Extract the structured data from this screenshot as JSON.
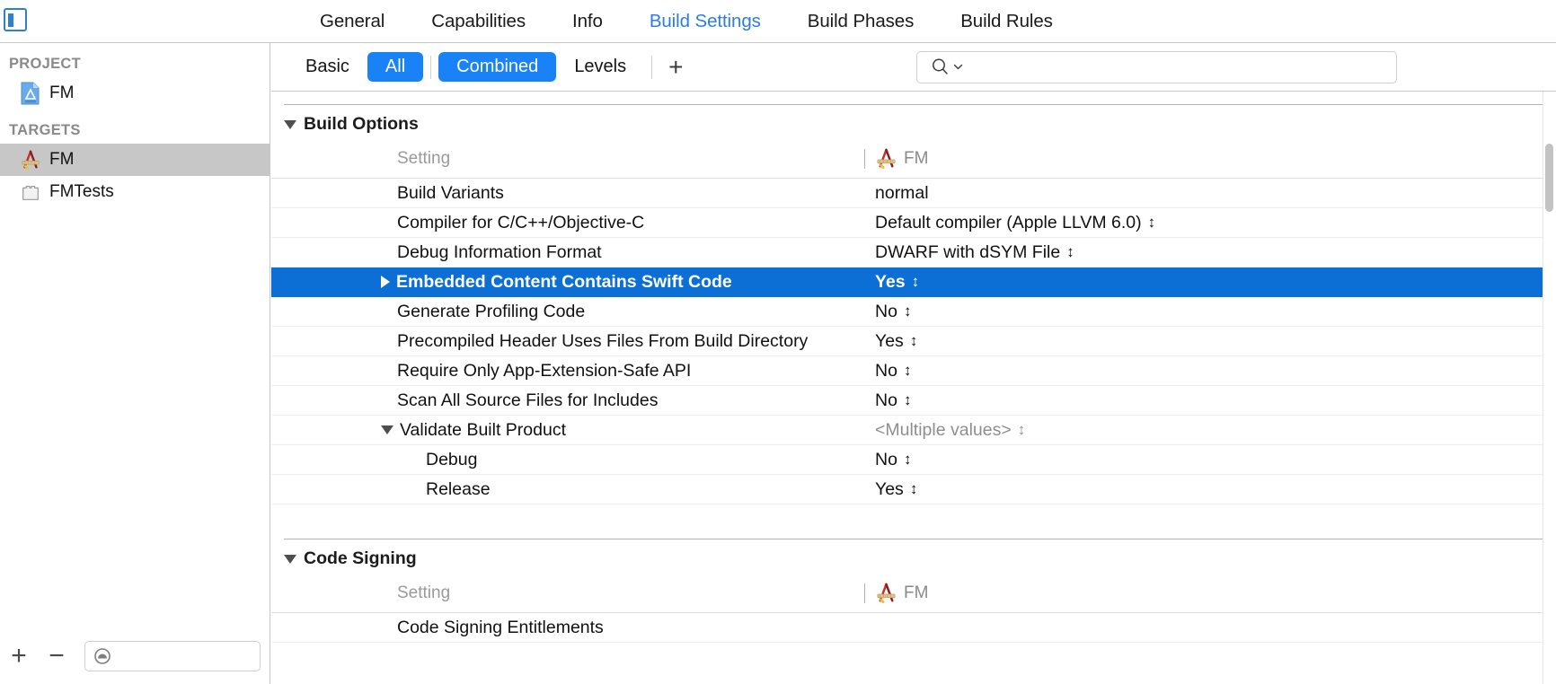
{
  "window": {
    "panel_toggle_icon": "navigator-toggle-icon"
  },
  "tabs": [
    {
      "label": "General",
      "active": false
    },
    {
      "label": "Capabilities",
      "active": false
    },
    {
      "label": "Info",
      "active": false
    },
    {
      "label": "Build Settings",
      "active": true
    },
    {
      "label": "Build Phases",
      "active": false
    },
    {
      "label": "Build Rules",
      "active": false
    }
  ],
  "sidebar": {
    "project_header": "PROJECT",
    "targets_header": "TARGETS",
    "project_items": [
      {
        "label": "FM",
        "icon": "xcode-project-icon",
        "selected": false
      }
    ],
    "target_items": [
      {
        "label": "FM",
        "icon": "xcode-target-app-icon",
        "selected": true
      },
      {
        "label": "FMTests",
        "icon": "xcode-test-bundle-icon",
        "selected": false
      }
    ],
    "add_button": "+",
    "remove_button": "−",
    "filter_placeholder": "",
    "filter_value": "",
    "filter_icon": "filter-circle-icon"
  },
  "toolbar": {
    "segments": [
      {
        "label": "Basic",
        "on": false
      },
      {
        "label": "All",
        "on": true
      },
      {
        "label": "Combined",
        "on": true
      },
      {
        "label": "Levels",
        "on": false
      }
    ],
    "add_setting_button": "+",
    "search_icon": "search-icon",
    "search_chevron_icon": "chevron-down-icon",
    "search_value": "",
    "search_placeholder": ""
  },
  "sections": [
    {
      "title": "Build Options",
      "expanded": true,
      "column_header": {
        "setting": "Setting",
        "target": "FM",
        "target_icon": "xcode-target-app-icon"
      },
      "rows": [
        {
          "name": "Build Variants",
          "value": "normal",
          "stepper": false,
          "disclosure": "none",
          "indent": 0,
          "selected": false,
          "muted": false
        },
        {
          "name": "Compiler for C/C++/Objective-C",
          "value": "Default compiler (Apple LLVM 6.0)",
          "stepper": true,
          "disclosure": "none",
          "indent": 0,
          "selected": false,
          "muted": false
        },
        {
          "name": "Debug Information Format",
          "value": "DWARF with dSYM File",
          "stepper": true,
          "disclosure": "none",
          "indent": 0,
          "selected": false,
          "muted": false
        },
        {
          "name": "Embedded Content Contains Swift Code",
          "value": "Yes",
          "stepper": true,
          "disclosure": "collapsed",
          "indent": 0,
          "selected": true,
          "muted": false
        },
        {
          "name": "Generate Profiling Code",
          "value": "No",
          "stepper": true,
          "disclosure": "none",
          "indent": 0,
          "selected": false,
          "muted": false
        },
        {
          "name": "Precompiled Header Uses Files From Build Directory",
          "value": "Yes",
          "stepper": true,
          "disclosure": "none",
          "indent": 0,
          "selected": false,
          "muted": false
        },
        {
          "name": "Require Only App-Extension-Safe API",
          "value": "No",
          "stepper": true,
          "disclosure": "none",
          "indent": 0,
          "selected": false,
          "muted": false
        },
        {
          "name": "Scan All Source Files for Includes",
          "value": "No",
          "stepper": true,
          "disclosure": "none",
          "indent": 0,
          "selected": false,
          "muted": false
        },
        {
          "name": "Validate Built Product",
          "value": "<Multiple values>",
          "stepper": true,
          "disclosure": "expanded",
          "indent": 0,
          "selected": false,
          "muted": true
        },
        {
          "name": "Debug",
          "value": "No",
          "stepper": true,
          "disclosure": "none",
          "indent": 1,
          "selected": false,
          "muted": false
        },
        {
          "name": "Release",
          "value": "Yes",
          "stepper": true,
          "disclosure": "none",
          "indent": 1,
          "selected": false,
          "muted": false
        }
      ]
    },
    {
      "title": "Code Signing",
      "expanded": true,
      "column_header": {
        "setting": "Setting",
        "target": "FM",
        "target_icon": "xcode-target-app-icon"
      },
      "rows": [
        {
          "name": "Code Signing Entitlements",
          "value": "",
          "stepper": false,
          "disclosure": "none",
          "indent": 0,
          "selected": false,
          "muted": false
        }
      ]
    }
  ],
  "colors": {
    "selection_blue": "#0b6fd6",
    "accent_blue": "#1a82f7",
    "tab_active_blue": "#2b7de1",
    "sidebar_selected_gray": "#c7c7c7",
    "muted_gray": "#8e8e8e"
  }
}
